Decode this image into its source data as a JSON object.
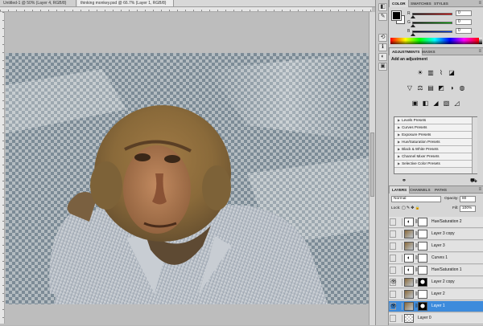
{
  "document": {
    "tabs": [
      {
        "label": "Untitled-1 @ 50% (Layer 4, RGB/8)"
      },
      {
        "label": "thinking monkey.psd @ 66.7% (Layer 1, RGB/8)"
      }
    ]
  },
  "icon_strip": {
    "icons": [
      "color-swatch-icon",
      "brush-icon",
      "history-icon",
      "info-icon",
      "adjust-icon",
      "mask-icon"
    ]
  },
  "color_panel": {
    "tabs": [
      "COLOR",
      "SWATCHES",
      "STYLES"
    ],
    "sliders": [
      {
        "letter": "R",
        "value": "0",
        "color": "#e03030"
      },
      {
        "letter": "G",
        "value": "0",
        "color": "#30a030"
      },
      {
        "letter": "B",
        "value": "0",
        "color": "#3050e0"
      }
    ],
    "foreground": "#000000",
    "background": "#ffffff"
  },
  "adjustments_panel": {
    "tabs": [
      "ADJUSTMENTS",
      "MASKS"
    ],
    "title": "Add an adjustment",
    "icon_rows": [
      [
        "☀",
        "▥",
        "⌇",
        "◪"
      ],
      [
        "▽",
        "⚖",
        "▤",
        "◩",
        "◑",
        "◍"
      ],
      [
        "▣",
        "◧",
        "◢",
        "▧",
        "◿"
      ]
    ],
    "presets": [
      "Levels Presets",
      "Curves Presets",
      "Exposure Presets",
      "Hue/Saturation Presets",
      "Black & White Presets",
      "Channel Mixer Presets",
      "Selective Color Presets"
    ]
  },
  "layers_panel": {
    "tabs": [
      "LAYERS",
      "CHANNELS",
      "PATHS"
    ],
    "blend_mode": "Normal",
    "opacity_label": "Opacity:",
    "opacity": "80",
    "lock_label": "Lock:",
    "fill_label": "Fill:",
    "fill": "100%",
    "layers": [
      {
        "name": "Hue/Saturation 2",
        "visible": false,
        "selected": false,
        "type": "adjust"
      },
      {
        "name": "Layer 3 copy",
        "visible": false,
        "selected": false,
        "type": "image"
      },
      {
        "name": "Layer 3",
        "visible": false,
        "selected": false,
        "type": "image"
      },
      {
        "name": "Curves 1",
        "visible": false,
        "selected": false,
        "type": "adjust"
      },
      {
        "name": "Hue/Saturation 1",
        "visible": false,
        "selected": false,
        "type": "adjust"
      },
      {
        "name": "Layer 2 copy",
        "visible": true,
        "selected": false,
        "type": "image"
      },
      {
        "name": "Layer 2",
        "visible": false,
        "selected": false,
        "type": "image"
      },
      {
        "name": "Layer 1",
        "visible": true,
        "selected": true,
        "type": "image"
      },
      {
        "name": "Layer 0",
        "visible": false,
        "selected": false,
        "type": "plain"
      }
    ]
  }
}
